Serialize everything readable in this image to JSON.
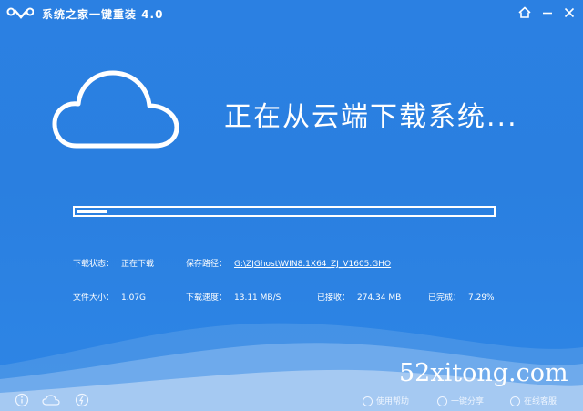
{
  "app": {
    "title": "系统之家一键重装 4.0",
    "accent_color": "#2b80e2"
  },
  "titlebar": {
    "icons": [
      "logo-icon",
      "home-icon",
      "minimize-icon",
      "close-icon"
    ]
  },
  "main": {
    "heading": "正在从云端下载系统...",
    "progress_fraction": 0.073
  },
  "status": {
    "state_label": "下载状态：",
    "state_value": "正在下载",
    "path_label": "保存路径：",
    "path_value": "G:\\ZJGhost\\WIN8.1X64_ZJ_V1605.GHO",
    "size_label": "文件大小：",
    "size_value": "1.07G",
    "speed_label": "下载速度：",
    "speed_value": "13.11 MB/S",
    "received_label": "已接收：",
    "received_value": "274.34 MB",
    "done_label": "已完成：",
    "done_value": "7.29%"
  },
  "footer": {
    "left_icons": [
      "info-icon",
      "cloud-icon",
      "cloud-lightning-icon"
    ],
    "help": "使用帮助",
    "share": "一键分享",
    "support": "在线客服"
  },
  "watermark": "52xitong.com"
}
